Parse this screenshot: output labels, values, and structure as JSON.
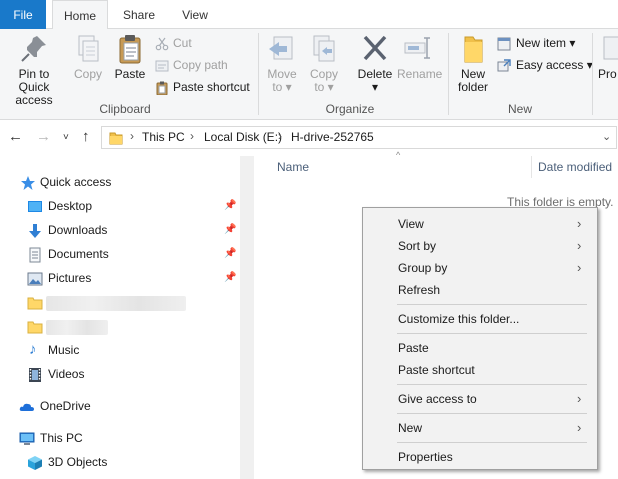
{
  "tabs": {
    "file": "File",
    "home": "Home",
    "share": "Share",
    "view": "View"
  },
  "ribbon": {
    "clipboard": {
      "pin": "Pin to Quick access",
      "pin_line1": "Pin to Quick",
      "pin_line2": "access",
      "copy": "Copy",
      "paste": "Paste",
      "cut": "Cut",
      "copy_path": "Copy path",
      "paste_shortcut": "Paste shortcut",
      "label": "Clipboard"
    },
    "organize": {
      "move_to": "Move",
      "move_to2": "to",
      "copy_to": "Copy",
      "copy_to2": "to",
      "delete": "Delete",
      "rename": "Rename",
      "label": "Organize"
    },
    "new": {
      "new_folder1": "New",
      "new_folder2": "folder",
      "new_item": "New item",
      "easy_access": "Easy access",
      "label": "New"
    },
    "properties_partial": "Pro"
  },
  "address": {
    "crumbs": [
      "This PC",
      "Local Disk (E:)",
      "H-drive-252765"
    ]
  },
  "nav": {
    "quick_access": "Quick access",
    "items": [
      {
        "label": "Desktop",
        "pinned": true
      },
      {
        "label": "Downloads",
        "pinned": true
      },
      {
        "label": "Documents",
        "pinned": true
      },
      {
        "label": "Pictures",
        "pinned": true
      }
    ],
    "music": "Music",
    "videos": "Videos",
    "onedrive": "OneDrive",
    "this_pc": "This PC",
    "objects3d": "3D Objects"
  },
  "content": {
    "col_name": "Name",
    "col_date": "Date modified",
    "empty_message": "This folder is empty."
  },
  "context_menu": {
    "view": "View",
    "sort_by": "Sort by",
    "group_by": "Group by",
    "refresh": "Refresh",
    "customize": "Customize this folder...",
    "paste": "Paste",
    "paste_shortcut": "Paste shortcut",
    "give_access": "Give access to",
    "new": "New",
    "properties": "Properties"
  },
  "colors": {
    "file_tab": "#1979ca",
    "ribbon_bg": "#f5f6f7",
    "menu_bg": "#f2f2f2"
  }
}
